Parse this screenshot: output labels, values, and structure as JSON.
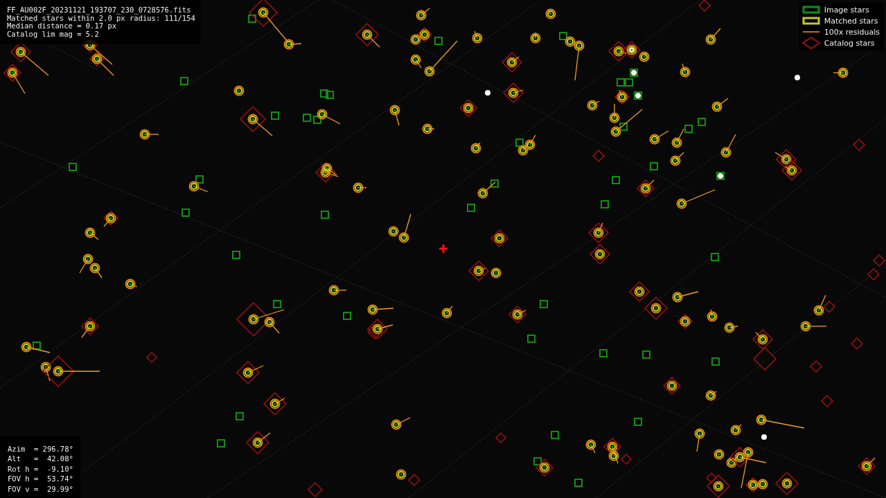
{
  "header_lines": [
    "FF_AU002F_20231121_193707_230_0728576.fits",
    "Matched stars within 2.0 px radius: 111/154",
    "Median distance = 0.17 px",
    "Catalog lim mag = 5.2"
  ],
  "legend": [
    {
      "kind": "image",
      "label": "Image stars"
    },
    {
      "kind": "matched",
      "label": "Matched stars"
    },
    {
      "kind": "residual",
      "label": "100x residuals"
    },
    {
      "kind": "catalog",
      "label": "Catalog stars"
    }
  ],
  "pointing_lines": [
    "Azim  = 296.78°",
    "Alt   =  42.08°",
    "Rot h =  -9.10°",
    "FOV h =  53.74°",
    "FOV v =  29.99°"
  ]
}
